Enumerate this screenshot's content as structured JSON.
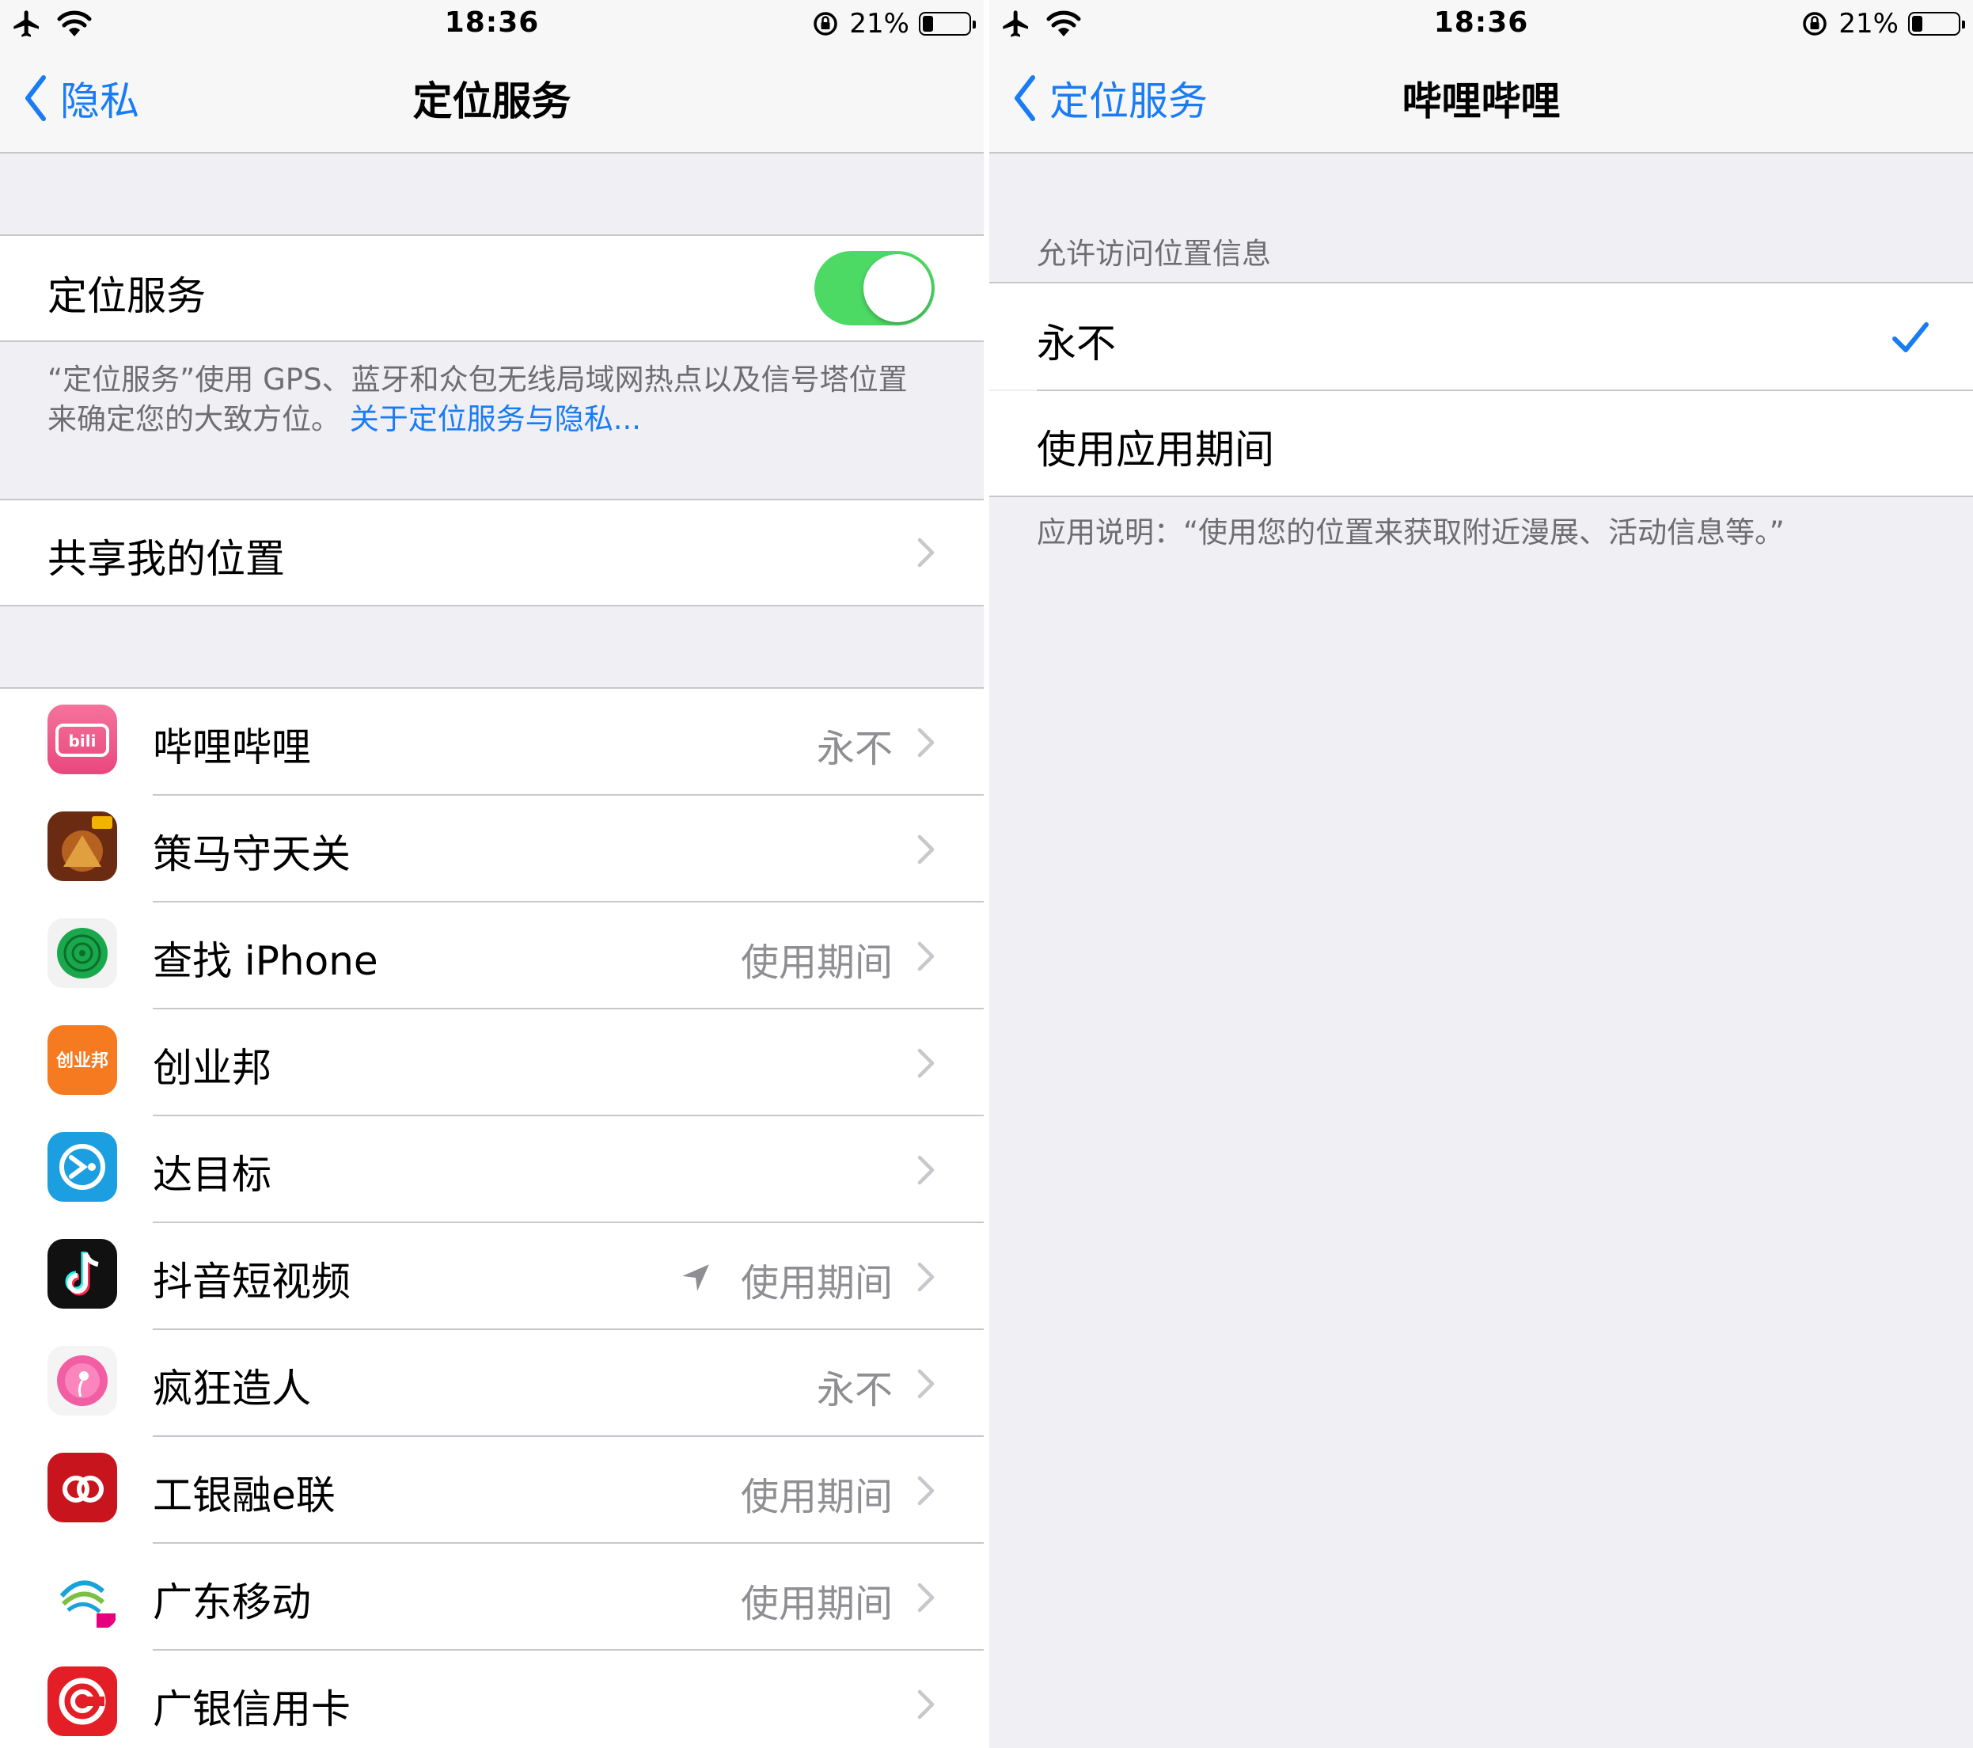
{
  "status_bar": {
    "time": "18:36",
    "battery_percent": "21%",
    "battery_level": 0.21
  },
  "left_screen": {
    "nav": {
      "back_label": "隐私",
      "title": "定位服务"
    },
    "location_services": {
      "label": "定位服务",
      "toggle_on": true
    },
    "footer": {
      "text": "“定位服务”使用 GPS、蓝牙和众包无线局域网热点以及信号塔位置来确定您的大致方位。",
      "link": "关于定位服务与隐私..."
    },
    "share_location": {
      "label": "共享我的位置"
    },
    "apps": [
      {
        "name": "哔哩哔哩",
        "value": "永不",
        "icon": "bilibili-icon"
      },
      {
        "name": "策马守天关",
        "value": "",
        "icon": "game-icon"
      },
      {
        "name": "查找 iPhone",
        "value": "使用期间",
        "icon": "find-iphone-icon"
      },
      {
        "name": "创业邦",
        "value": "",
        "icon": "chuangyebang-icon",
        "icon_text": "创业邦"
      },
      {
        "name": "达目标",
        "value": "",
        "icon": "damubiao-icon"
      },
      {
        "name": "抖音短视频",
        "value": "使用期间",
        "icon": "douyin-icon",
        "location_arrow": true
      },
      {
        "name": "疯狂造人",
        "value": "永不",
        "icon": "crazy-icon"
      },
      {
        "name": "工银融e联",
        "value": "使用期间",
        "icon": "icbc-icon"
      },
      {
        "name": "广东移动",
        "value": "使用期间",
        "icon": "china-mobile-icon"
      },
      {
        "name": "广银信用卡",
        "value": "",
        "icon": "cgb-card-icon"
      }
    ]
  },
  "right_screen": {
    "nav": {
      "back_label": "定位服务",
      "title": "哔哩哔哩"
    },
    "section_header": "允许访问位置信息",
    "options": [
      {
        "label": "永不",
        "selected": true
      },
      {
        "label": "使用应用期间",
        "selected": false
      }
    ],
    "footer": "应用说明：“使用您的位置来获取附近漫展、活动信息等。”"
  },
  "colors": {
    "accent": "#1a7cf5",
    "toggle_on": "#4cd964",
    "background": "#efeff4",
    "secondary_text": "#8e8e93"
  }
}
